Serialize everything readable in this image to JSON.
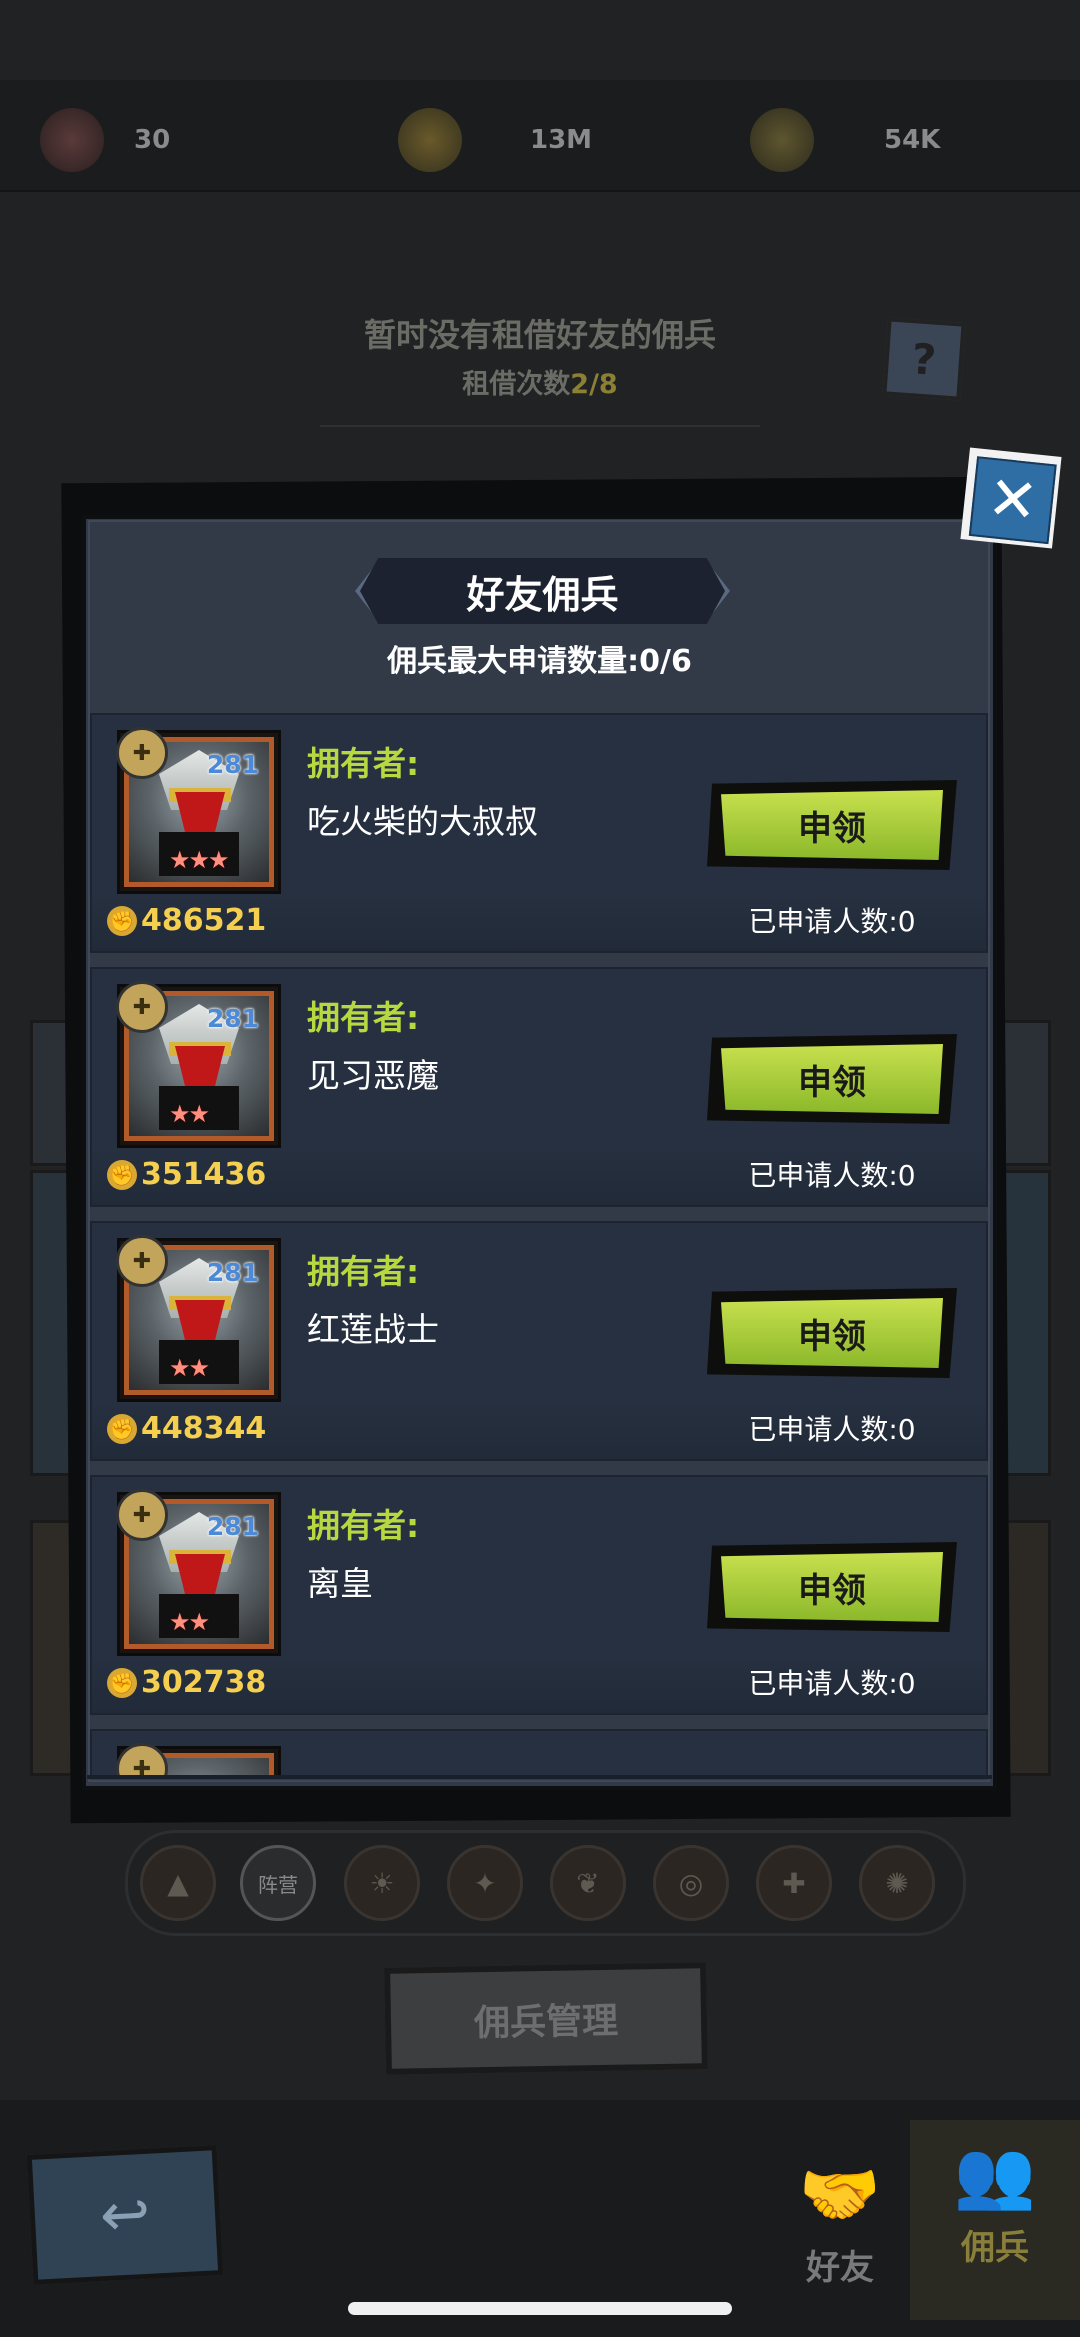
{
  "background": {
    "resources": [
      {
        "icon": "heart-stamina-icon",
        "value": "30"
      },
      {
        "icon": "coin-icon",
        "value": "13M"
      },
      {
        "icon": "gold-trophy-icon",
        "value": "54K"
      }
    ],
    "info_line1": "暂时没有租借好友的佣兵",
    "info_line2_label": "租借次数",
    "info_line2_value": "2/8",
    "help_glyph": "?",
    "filter_camp_label": "阵营",
    "manage_button": "佣兵管理",
    "tabs": {
      "friend": "好友",
      "mercenary": "佣兵"
    }
  },
  "modal": {
    "title": "好友佣兵",
    "subtitle": "佣兵最大申请数量:0/6",
    "close_glyph": "✕",
    "owner_label": "拥有者:",
    "apply_label": "申领",
    "applied_label": "已申请人数:0",
    "rows": [
      {
        "level": "281",
        "stars": "★★★",
        "power": "486521",
        "owner": "吃火柴的大叔叔"
      },
      {
        "level": "281",
        "stars": "★★",
        "power": "351436",
        "owner": "见习恶魔"
      },
      {
        "level": "281",
        "stars": "★★",
        "power": "448344",
        "owner": "红莲战士"
      },
      {
        "level": "281",
        "stars": "★★",
        "power": "302738",
        "owner": "离皇"
      }
    ]
  },
  "colors": {
    "accent_green": "#b8d840",
    "power_gold": "#f5d050",
    "close_blue": "#2f6ea5",
    "level_blue": "#4c8ad8"
  }
}
